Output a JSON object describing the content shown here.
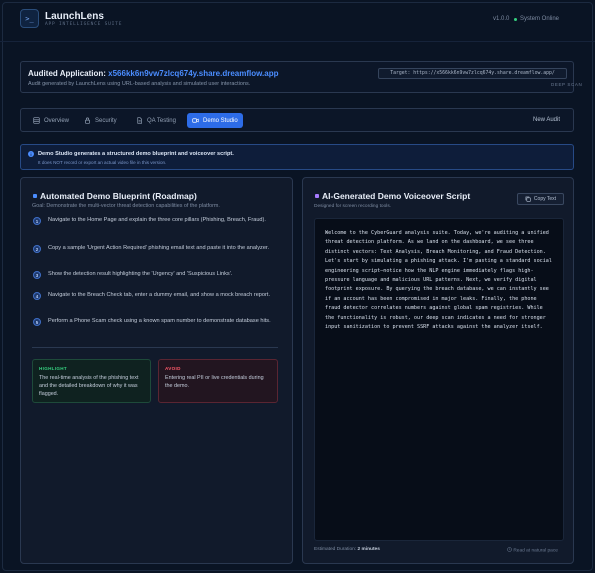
{
  "header": {
    "logo_glyph": ">_",
    "app_name": "LaunchLens",
    "app_subtitle": "APP INTELLIGENCE SUITE",
    "version": "v1.0.0",
    "status": "System Online"
  },
  "audit": {
    "title_prefix": "Audited Application:",
    "host": "x566kk6n9vw7zlcq674y.share.dreamflow.app",
    "description": "Audit generated by LaunchLens using URL-based analysis and simulated user interactions.",
    "target_label": "Target: https://x566kk6n9vw7zlcq674y.share.dreamflow.app/",
    "scan_type": "DEEP SCAN"
  },
  "tabs": [
    {
      "label": "Overview",
      "icon": "grid-icon",
      "active": false
    },
    {
      "label": "Security",
      "icon": "lock-icon",
      "active": false
    },
    {
      "label": "QA Testing",
      "icon": "document-icon",
      "active": false
    },
    {
      "label": "Demo Studio",
      "icon": "video-icon",
      "active": true
    }
  ],
  "new_audit_label": "New Audit",
  "info": {
    "title": "Demo Studio generates a structured demo blueprint and voiceover script.",
    "subtitle": "It does NOT record or export an actual video file in this version."
  },
  "blueprint": {
    "title": "Automated Demo Blueprint (Roadmap)",
    "goal": "Goal: Demonstrate the multi-vector threat detection capabilities of the platform.",
    "steps": [
      {
        "num": "1",
        "text": "Navigate to the Home Page and explain the three core pillars (Phishing, Breach, Fraud)."
      },
      {
        "num": "2",
        "text": "Copy a sample 'Urgent Action Required' phishing email text and paste it into the analyzer."
      },
      {
        "num": "3",
        "text": "Show the detection result highlighting the 'Urgency' and 'Suspicious Links'."
      },
      {
        "num": "4",
        "text": "Navigate to the Breach Check tab, enter a dummy email, and show a mock breach report."
      },
      {
        "num": "5",
        "text": "Perform a Phone Scam check using a known spam number to demonstrate database hits."
      }
    ],
    "highlight_label": "HIGHLIGHT",
    "highlight_text": "The real-time analysis of the phishing text and the detailed breakdown of why it was flagged.",
    "avoid_label": "AVOID",
    "avoid_text": "Entering real PII or live credentials during the demo."
  },
  "voiceover": {
    "title": "AI-Generated Demo Voiceover Script",
    "subtitle": "Designed for screen recording tools.",
    "copy_label": "Copy Text",
    "script": "Welcome to the CyberGuard analysis suite. Today, we're auditing a unified threat detection platform. As we land on the dashboard, we see three distinct vectors: Text Analysis, Breach Monitoring, and Fraud Detection. Let's start by simulating a phishing attack. I'm pasting a standard social engineering script—notice how the NLP engine immediately flags high-pressure language and malicious URL patterns. Next, we verify digital footprint exposure. By querying the breach database, we can instantly see if an account has been compromised in major leaks. Finally, the phone fraud detector correlates numbers against global spam registries. While the functionality is robust, our deep scan indicates a need for stronger input sanitization to prevent SSRF attacks against the analyzer itself.",
    "duration_label": "Estimated Duration:",
    "duration_value": "2 minutes",
    "pace": "Read at natural pace"
  },
  "colors": {
    "accent": "#2d6ce8",
    "link": "#4b8dff",
    "online": "#35d07f",
    "avoid": "#ff5a6a",
    "background": "#0a1424"
  }
}
